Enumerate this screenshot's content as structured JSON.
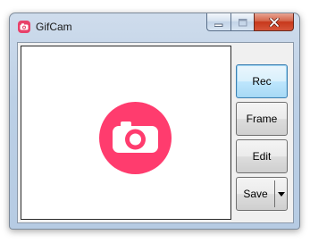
{
  "window": {
    "title": "GifCam",
    "icons": {
      "app": "camera-icon",
      "minimize": "minimize-icon",
      "maximize": "maximize-icon",
      "close": "close-icon",
      "logo": "camera-icon",
      "dropdown": "chevron-down-icon"
    }
  },
  "buttons": {
    "rec": "Rec",
    "frame": "Frame",
    "edit": "Edit",
    "save": "Save"
  },
  "colors": {
    "brand": "#ff3c6e",
    "rec_highlight": "#3c7fb1"
  }
}
